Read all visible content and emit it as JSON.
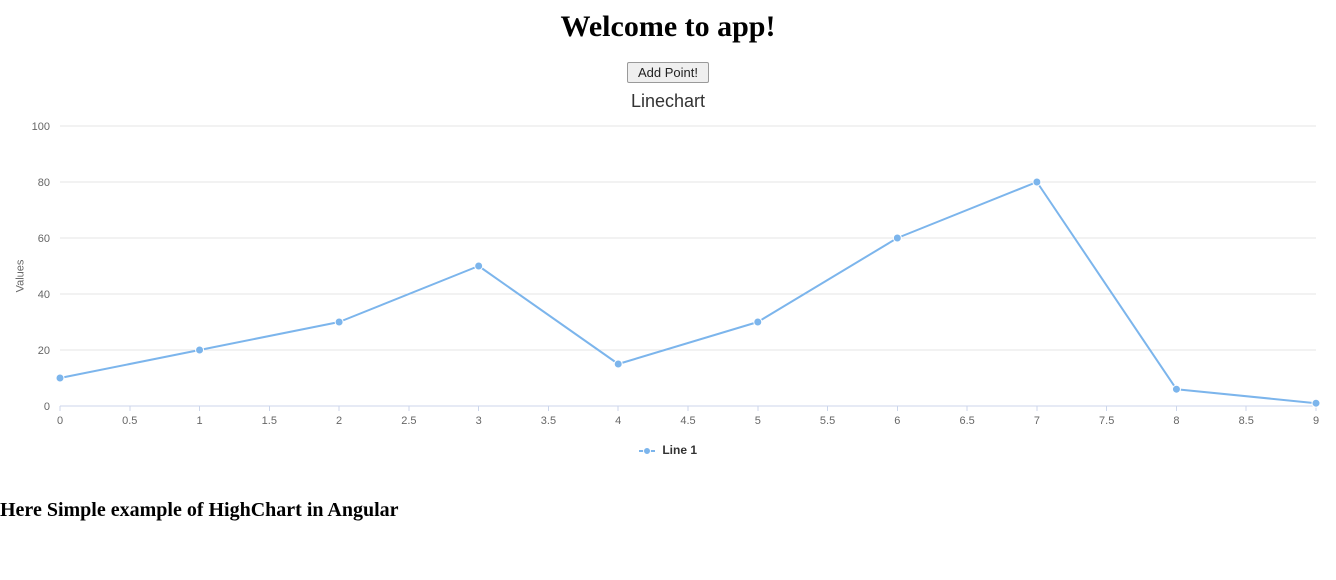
{
  "heading": "Welcome to app!",
  "button_label": "Add Point!",
  "chart_title": "Linechart",
  "y_axis_title": "Values",
  "legend_label": "Line 1",
  "sub_heading": "Here Simple example of HighChart in Angular",
  "chart_data": {
    "type": "line",
    "title": "Linechart",
    "xlabel": "",
    "ylabel": "Values",
    "x": [
      0,
      1,
      2,
      3,
      4,
      5,
      6,
      7,
      8,
      9
    ],
    "x_ticks": [
      0,
      0.5,
      1,
      1.5,
      2,
      2.5,
      3,
      3.5,
      4,
      4.5,
      5,
      5.5,
      6,
      6.5,
      7,
      7.5,
      8,
      8.5,
      9
    ],
    "series": [
      {
        "name": "Line 1",
        "values": [
          10,
          20,
          30,
          50,
          15,
          30,
          60,
          80,
          6,
          1
        ]
      }
    ],
    "ylim": [
      0,
      100
    ],
    "y_ticks": [
      0,
      20,
      40,
      60,
      80,
      100
    ],
    "legend_position": "bottom",
    "grid": true,
    "line_color": "#7cb5ec"
  }
}
